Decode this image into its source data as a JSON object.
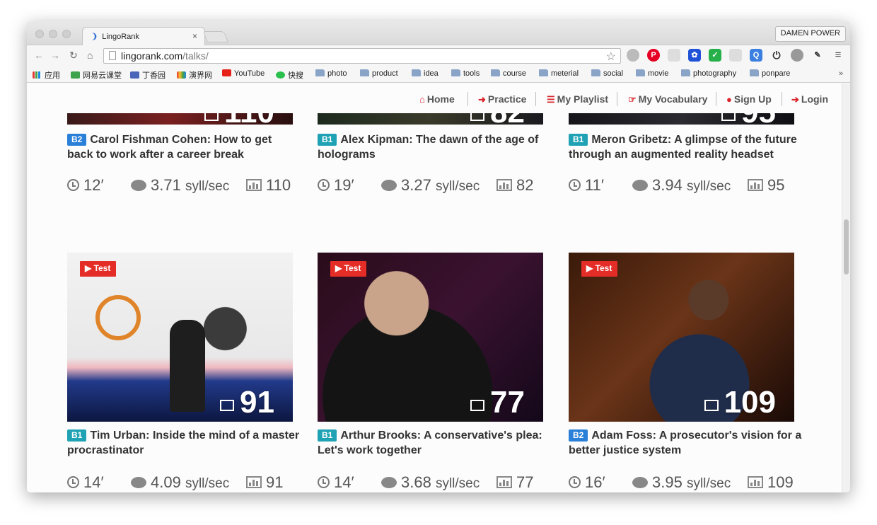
{
  "browser": {
    "tab_title": "LingoRank",
    "tab_close": "×",
    "profile_name": "DAMEN POWER",
    "url_host": "lingorank.com",
    "url_path": "/talks/",
    "bookmarks": [
      {
        "label": "应用",
        "icon": "apps-grid-icon"
      },
      {
        "label": "网易云课堂",
        "icon": "green-book-icon"
      },
      {
        "label": "丁香园",
        "icon": "flower-icon"
      },
      {
        "label": "演界网",
        "icon": "rainbow-icon"
      },
      {
        "label": "YouTube",
        "icon": "youtube-icon"
      },
      {
        "label": "快搜",
        "icon": "green-search-icon"
      },
      {
        "label": "photo",
        "icon": "folder-icon"
      },
      {
        "label": "product",
        "icon": "folder-icon"
      },
      {
        "label": "idea",
        "icon": "folder-icon"
      },
      {
        "label": "tools",
        "icon": "folder-icon"
      },
      {
        "label": "course",
        "icon": "folder-icon"
      },
      {
        "label": "meterial",
        "icon": "folder-icon"
      },
      {
        "label": "social",
        "icon": "folder-icon"
      },
      {
        "label": "movie",
        "icon": "folder-icon"
      },
      {
        "label": "photography",
        "icon": "folder-icon"
      },
      {
        "label": "ponpare",
        "icon": "folder-icon"
      }
    ],
    "more": "»"
  },
  "site_nav": [
    {
      "label": "Home",
      "icon": "home-icon",
      "glyph": "⌂"
    },
    {
      "label": "Practice",
      "icon": "arrow-circle-icon",
      "glyph": "➜"
    },
    {
      "label": "My Playlist",
      "icon": "list-icon",
      "glyph": "☰"
    },
    {
      "label": "My Vocabulary",
      "icon": "hand-pointer-icon",
      "glyph": "☞"
    },
    {
      "label": "Sign Up",
      "icon": "user-icon",
      "glyph": "●"
    },
    {
      "label": "Login",
      "icon": "login-icon",
      "glyph": "➔"
    }
  ],
  "talks_top": [
    {
      "level": "B2",
      "title": "Carol Fishman Cohen: How to get back to work after a career break",
      "minutes": "12",
      "syll": "3.71",
      "unit": "syll/sec",
      "score": "110"
    },
    {
      "level": "B1",
      "title": "Alex Kipman: The dawn of the age of holograms",
      "minutes": "19",
      "syll": "3.27",
      "unit": "syll/sec",
      "score": "82"
    },
    {
      "level": "B1",
      "title": "Meron Gribetz: A glimpse of the future through an augmented reality headset",
      "minutes": "11",
      "syll": "3.94",
      "unit": "syll/sec",
      "score": "95"
    }
  ],
  "talks_bottom": [
    {
      "level": "B1",
      "badge": "Test",
      "title": "Tim Urban: Inside the mind of a master procrastinator",
      "minutes": "14",
      "syll": "4.09",
      "unit": "syll/sec",
      "score": "91"
    },
    {
      "level": "B1",
      "badge": "Test",
      "title": "Arthur Brooks: A conservative's plea: Let's work together",
      "minutes": "14",
      "syll": "3.68",
      "unit": "syll/sec",
      "score": "77"
    },
    {
      "level": "B2",
      "badge": "Test",
      "title": "Adam Foss: A prosecutor's vision for a better justice system",
      "minutes": "16",
      "syll": "3.95",
      "unit": "syll/sec",
      "score": "109"
    }
  ],
  "minute_mark": "′",
  "colors": {
    "accent": "#d9262c",
    "b1": "#1ea2b4",
    "b2": "#2a7fd8",
    "test_badge": "#e52d27"
  }
}
